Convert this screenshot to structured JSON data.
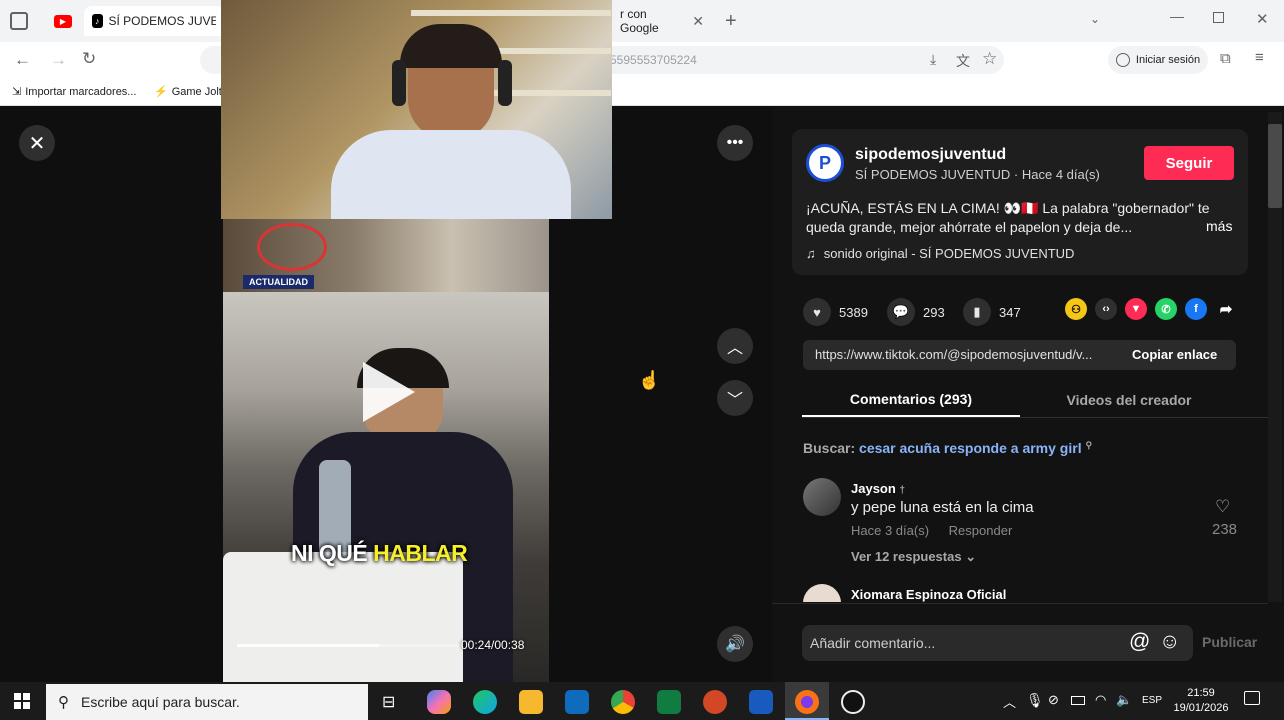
{
  "browser": {
    "tabs": [
      {
        "label": ""
      },
      {
        "label": "SÍ PODEMOS JUVENTUD"
      },
      {
        "label": "r con Google"
      }
    ],
    "url_fragment": "5595553705224",
    "sign_in_label": "Iniciar sesión",
    "bookmarks": [
      "Importar marcadores...",
      "Game Jolt"
    ]
  },
  "video": {
    "caption_part1": "NI QUÉ",
    "caption_part2": "HABLAR",
    "time": "00:24/00:38",
    "progress": 0.63,
    "thumb_label": "ACTUALIDAD"
  },
  "post": {
    "username": "sipodemosjuventud",
    "display_name": "SÍ PODEMOS JUVENTUD",
    "age": "Hace 4 día(s)",
    "follow_label": "Seguir",
    "description": "¡ACUÑA, ESTÁS EN LA CIMA! 👀🇵🇪 La palabra \"gobernador\" te queda grande, mejor ahórrate el papelon y deja de...",
    "more_label": "más",
    "sound": "sonido original - SÍ PODEMOS JUVENTUD",
    "likes": "5389",
    "comments": "293",
    "saves": "347",
    "link": "https://www.tiktok.com/@sipodemosjuventud/v...",
    "copy_label": "Copiar enlace"
  },
  "tabs": {
    "comments": "Comentarios (293)",
    "creator": "Videos del creador"
  },
  "search": {
    "prefix": "Buscar:",
    "query": "cesar acuña responde a army girl"
  },
  "comments": [
    {
      "user": "Jayson",
      "badge": "†",
      "text": "y pepe luna está en la cima",
      "age": "Hace 3 día(s)",
      "reply": "Responder",
      "likes": "238",
      "replies": "Ver 12 respuestas"
    },
    {
      "user": "Xiomara Espinoza Oficial"
    }
  ],
  "composer": {
    "placeholder": "Añadir comentario...",
    "publish": "Publicar"
  },
  "taskbar": {
    "search_placeholder": "Escribe aquí para buscar.",
    "language": "ESP",
    "time": "21:59",
    "date": "19/01/2026"
  },
  "colors": {
    "accent": "#fe2c55",
    "link": "#8ab4f8"
  }
}
